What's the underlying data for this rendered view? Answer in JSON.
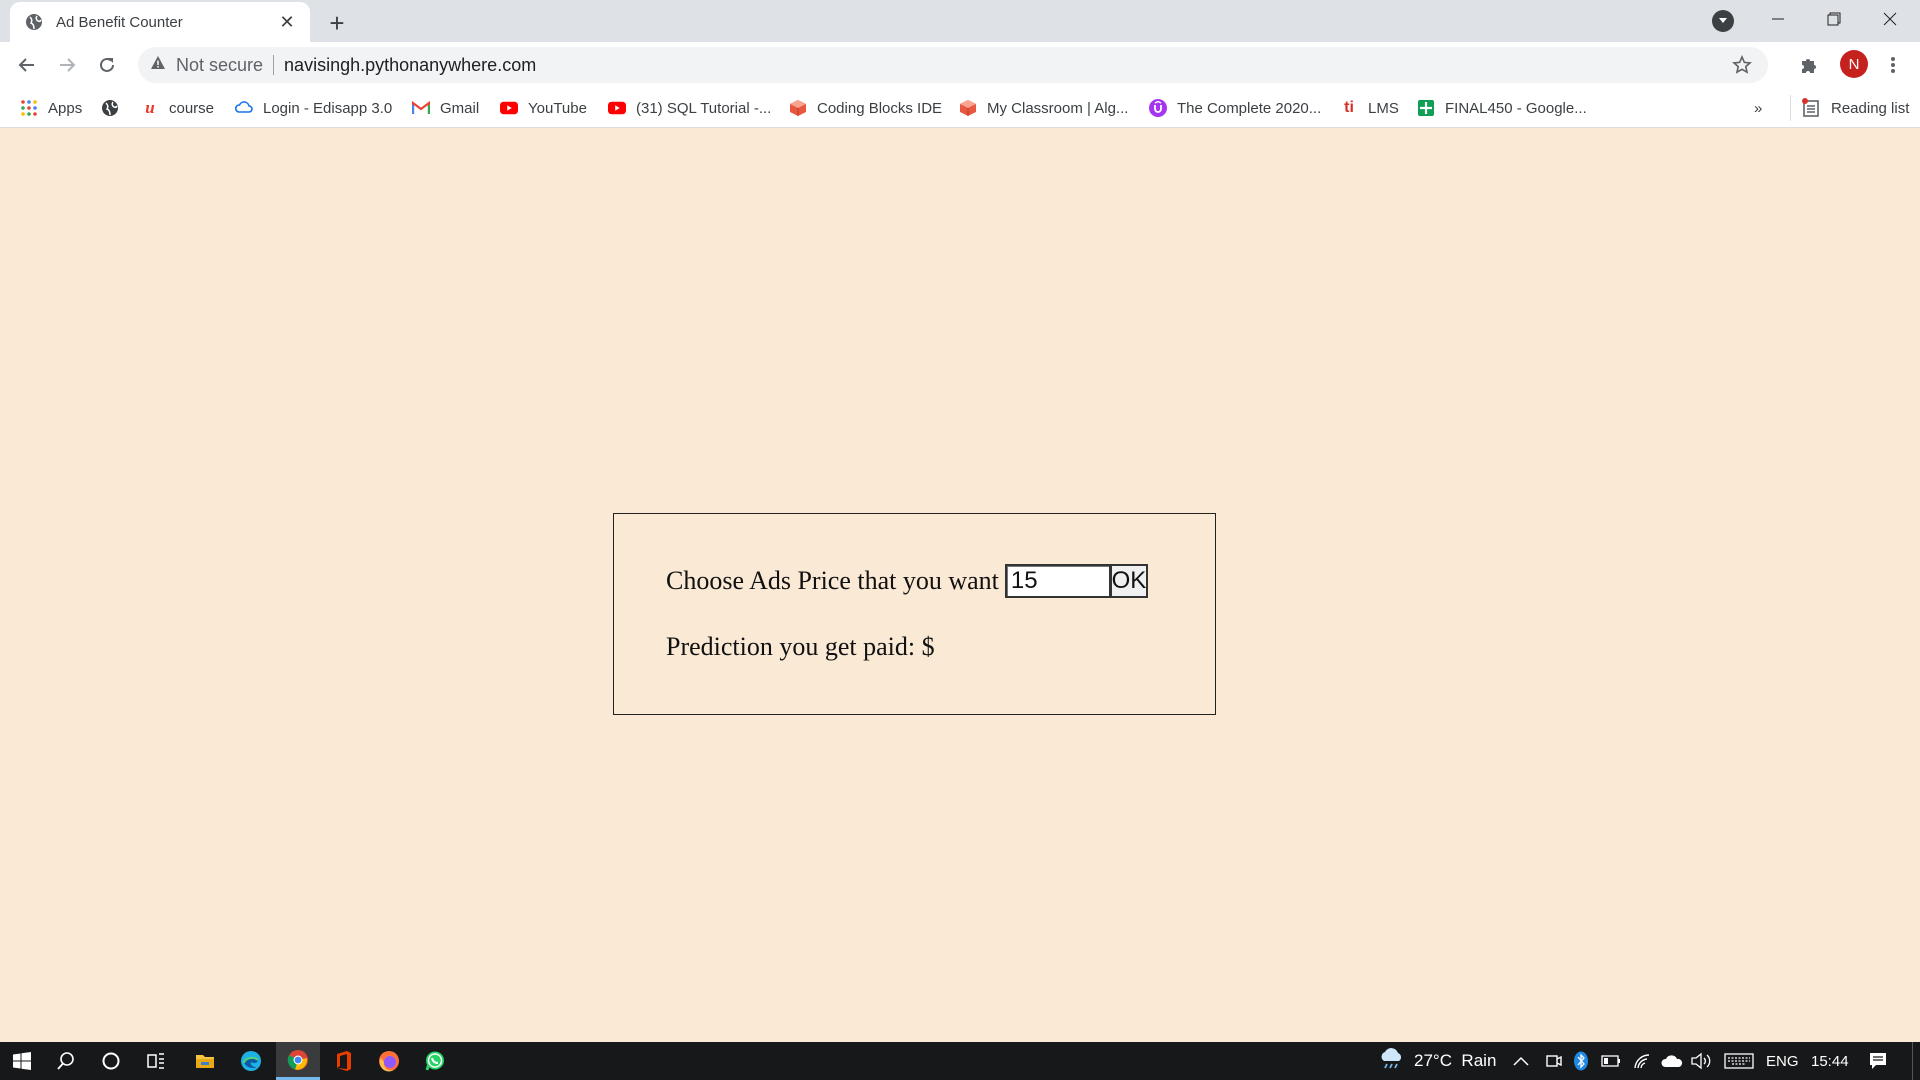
{
  "tab": {
    "title": "Ad Benefit Counter"
  },
  "omnibox": {
    "security_label": "Not secure",
    "url": "navisingh.pythonanywhere.com"
  },
  "profile": {
    "initial": "N"
  },
  "bookmarks": [
    {
      "label": "Apps",
      "icon": "apps-grid-icon"
    },
    {
      "label": "",
      "icon": "globe-icon"
    },
    {
      "label": "course",
      "icon": "u-logo-icon"
    },
    {
      "label": "Login - Edisapp 3.0",
      "icon": "cloud-icon"
    },
    {
      "label": "Gmail",
      "icon": "gmail-icon"
    },
    {
      "label": "YouTube",
      "icon": "youtube-icon"
    },
    {
      "label": "(31) SQL Tutorial -...",
      "icon": "youtube-icon"
    },
    {
      "label": "Coding Blocks IDE",
      "icon": "cube-icon"
    },
    {
      "label": "My Classroom | Alg...",
      "icon": "cube-icon"
    },
    {
      "label": "The Complete 2020...",
      "icon": "udemy-icon"
    },
    {
      "label": "LMS",
      "icon": "lms-icon"
    },
    {
      "label": "FINAL450 - Google...",
      "icon": "sheets-icon"
    }
  ],
  "overflow_label": "»",
  "reading_list": {
    "label": "Reading list"
  },
  "form": {
    "price_label": "Choose Ads Price that you want",
    "price_value": "15",
    "ok_label": "OK",
    "prediction_label": "Prediction you get paid: $"
  },
  "taskbar": {
    "weather": "27°C  Rain",
    "language": "ENG",
    "time": "15:44"
  },
  "colors": {
    "page_bg": "#fae9d5",
    "tab_strip": "#dee1e6",
    "avatar": "#c5221f"
  }
}
